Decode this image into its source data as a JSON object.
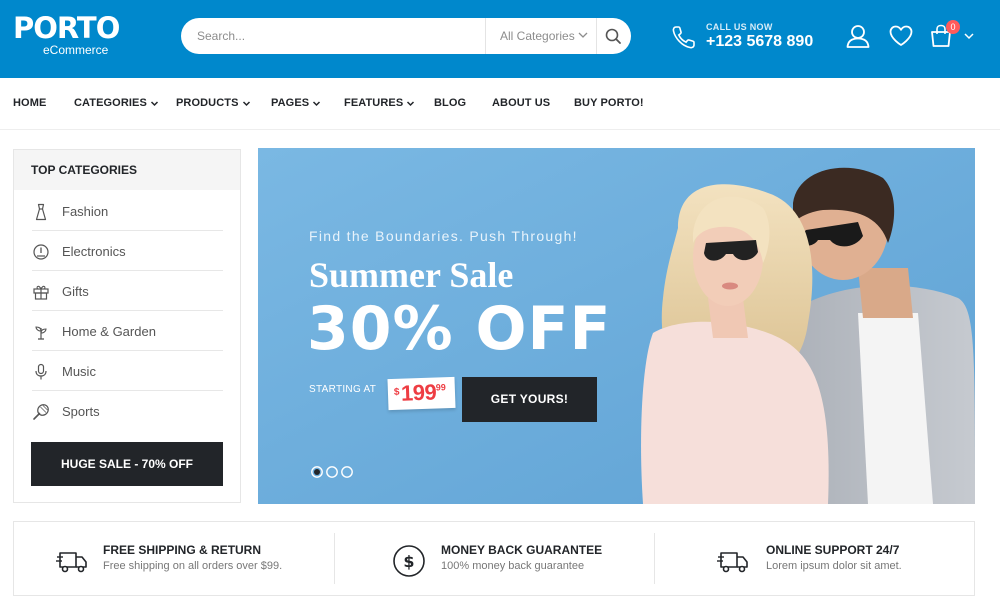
{
  "header": {
    "logo_main": "PORTO",
    "logo_sub": "eCommerce",
    "search_placeholder": "Search...",
    "search_category": "All Categories",
    "call_label": "CALL US NOW",
    "call_number": "+123 5678 890",
    "cart_count": "0",
    "accent_color": "#0088cc"
  },
  "nav": {
    "items": [
      {
        "label": "HOME"
      },
      {
        "label": "CATEGORIES"
      },
      {
        "label": "PRODUCTS"
      },
      {
        "label": "PAGES"
      },
      {
        "label": "FEATURES"
      },
      {
        "label": "BLOG"
      },
      {
        "label": "ABOUT US"
      },
      {
        "label": "BUY PORTO!"
      }
    ]
  },
  "sidebar": {
    "title": "TOP CATEGORIES",
    "items": [
      {
        "label": "Fashion",
        "icon": "dress-icon"
      },
      {
        "label": "Electronics",
        "icon": "electronics-icon"
      },
      {
        "label": "Gifts",
        "icon": "gift-icon"
      },
      {
        "label": "Home & Garden",
        "icon": "plant-icon"
      },
      {
        "label": "Music",
        "icon": "microphone-icon"
      },
      {
        "label": "Sports",
        "icon": "racket-icon"
      }
    ],
    "sale_label": "HUGE SALE - 70% OFF"
  },
  "banner": {
    "tagline": "Find the Boundaries. Push Through!",
    "title": "Summer Sale",
    "discount": "30% OFF",
    "starting_at": "STARTING AT",
    "price_currency": "$",
    "price_main": "199",
    "price_cents": "99",
    "cta_label": "GET YOURS!",
    "price_color": "#ee3d43",
    "active_slide": 1,
    "slide_count": 3
  },
  "features": [
    {
      "title": "FREE SHIPPING & RETURN",
      "subtitle": "Free shipping on all orders over $99.",
      "icon": "truck-icon"
    },
    {
      "title": "MONEY BACK GUARANTEE",
      "subtitle": "100% money back guarantee",
      "icon": "dollar-icon"
    },
    {
      "title": "ONLINE SUPPORT 24/7",
      "subtitle": "Lorem ipsum dolor sit amet.",
      "icon": "truck-icon"
    }
  ]
}
